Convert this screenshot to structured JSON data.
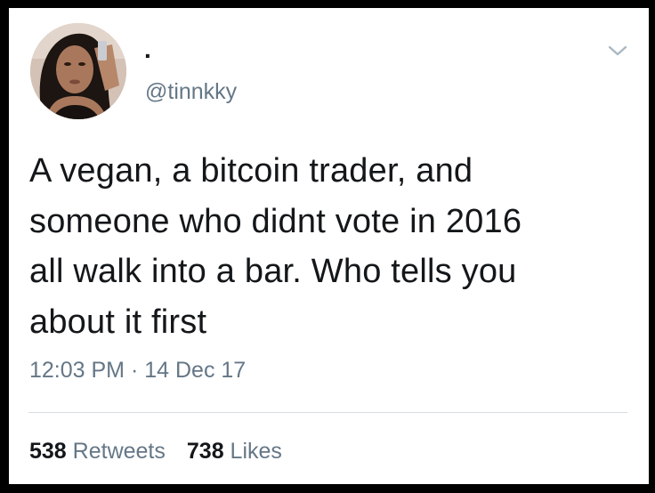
{
  "tweet": {
    "display_name": ".",
    "handle": "@tinnkky",
    "text": "A vegan, a bitcoin trader, and\nsomeone who didnt vote in 2016\nall walk into a bar. Who tells you\nabout it first",
    "time": "12:03 PM",
    "separator": " · ",
    "date": "14 Dec 17",
    "retweets_count": "538",
    "retweets_label": " Retweets",
    "likes_count": "738",
    "likes_label": " Likes"
  },
  "icons": {
    "menu": "chevron-down-icon",
    "avatar": "profile-photo"
  },
  "colors": {
    "text_primary": "#14171a",
    "text_secondary": "#657786",
    "divider": "#d8dde1",
    "background": "#ffffff",
    "border": "#000000"
  }
}
